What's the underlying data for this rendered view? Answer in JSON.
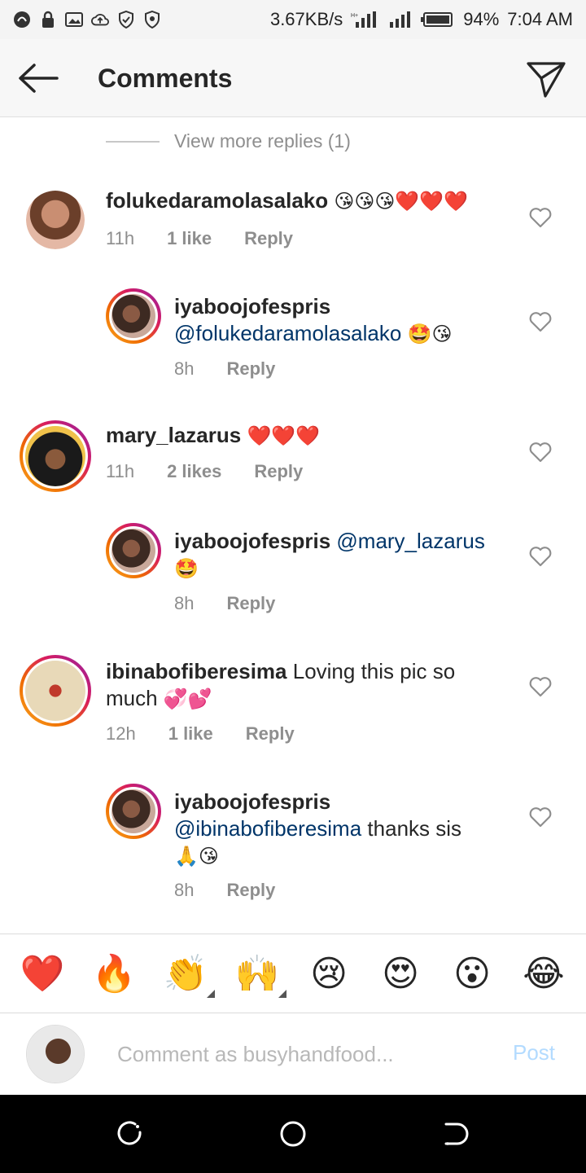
{
  "status_bar": {
    "speed": "3.67KB/s",
    "battery": "94%",
    "time": "7:04 AM"
  },
  "header": {
    "title": "Comments"
  },
  "view_more_replies": "View more replies (1)",
  "comments": [
    {
      "username": "folukedaramolasalako",
      "text": "",
      "emoji": "😘😘😘❤️❤️❤️",
      "time": "11h",
      "likes": "1 like",
      "reply_label": "Reply"
    },
    {
      "username": "iyaboojofespris",
      "mention": "@folukedaramolasalako",
      "text": "",
      "emoji": "🤩😘",
      "time": "8h",
      "reply_label": "Reply"
    },
    {
      "username": "mary_lazarus",
      "text": "",
      "emoji": "❤️❤️❤️",
      "time": "11h",
      "likes": "2 likes",
      "reply_label": "Reply"
    },
    {
      "username": "iyaboojofespris",
      "mention": "@mary_lazarus",
      "text": "",
      "emoji": "🤩",
      "time": "8h",
      "reply_label": "Reply"
    },
    {
      "username": "ibinabofiberesima",
      "text": "Loving this pic so much",
      "emoji": "💞💕",
      "time": "12h",
      "likes": "1 like",
      "reply_label": "Reply"
    },
    {
      "username": "iyaboojofespris",
      "mention": "@ibinabofiberesima",
      "text": "thanks sis",
      "emoji": "🙏😘",
      "time": "8h",
      "reply_label": "Reply"
    }
  ],
  "reactions": [
    "❤️",
    "🔥",
    "👏",
    "🙌",
    "😢",
    "😍",
    "😮",
    "😂"
  ],
  "composer": {
    "placeholder": "Comment as busyhandfood...",
    "post_label": "Post"
  },
  "colors": {
    "mention": "#003569",
    "secondary_text": "#8e8e8e",
    "post_disabled": "#b3dbff"
  },
  "icons": {
    "back": "arrow-left-icon",
    "send": "paper-plane-icon",
    "like": "heart-outline-icon"
  }
}
